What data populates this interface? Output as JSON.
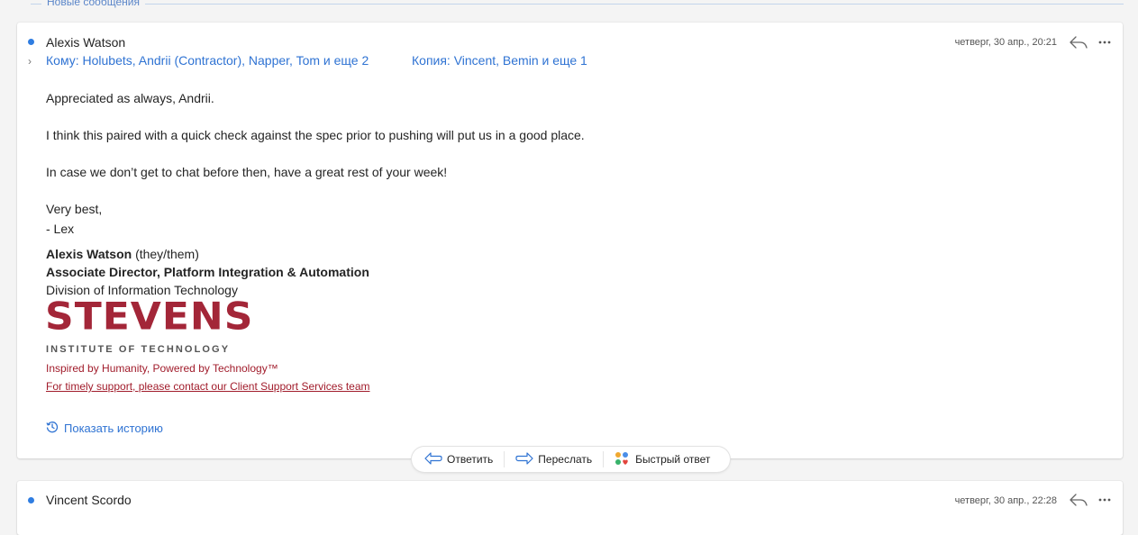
{
  "divider": {
    "label": "Новые сообщения"
  },
  "message": {
    "sender": "Alexis Watson",
    "date": "четверг, 30 апр., 20:21",
    "to": "Кому: Holubets, Andrii (Contractor), Napper, Tom и еще 2",
    "cc": "Копия: Vincent, Bemin и еще 1",
    "body": [
      "Appreciated as always, Andrii.",
      "I think this paired with a quick check against the spec prior to pushing will put us in a good place.",
      "In case we don’t get to chat before then, have a great rest of your week!",
      "Very best,",
      "- Lex"
    ],
    "signature": {
      "name": "Alexis Watson",
      "pronouns": "(they/them)",
      "title": "Associate Director, Platform Integration & Automation",
      "division": "Division of Information Technology",
      "logo_main": "STEVENS",
      "logo_sub": "INSTITUTE OF TECHNOLOGY",
      "tagline": "Inspired by Humanity, Powered by Technology™",
      "support_link": "For timely support, please contact our Client Support Services team"
    },
    "show_history": "Показать историю"
  },
  "actions": {
    "reply": "Ответить",
    "forward": "Переслать",
    "quick_reply": "Быстрый ответ"
  },
  "next_message": {
    "sender": "Vincent Scordo",
    "date": "четверг, 30 апр., 22:28"
  },
  "colors": {
    "accent": "#2f73d3",
    "brand": "#a32638",
    "unread": "#2f7de1"
  },
  "icons": [
    "reply-icon",
    "more-icon",
    "chevron-right-icon",
    "history-icon",
    "forward-icon",
    "quick-reply-icon"
  ]
}
